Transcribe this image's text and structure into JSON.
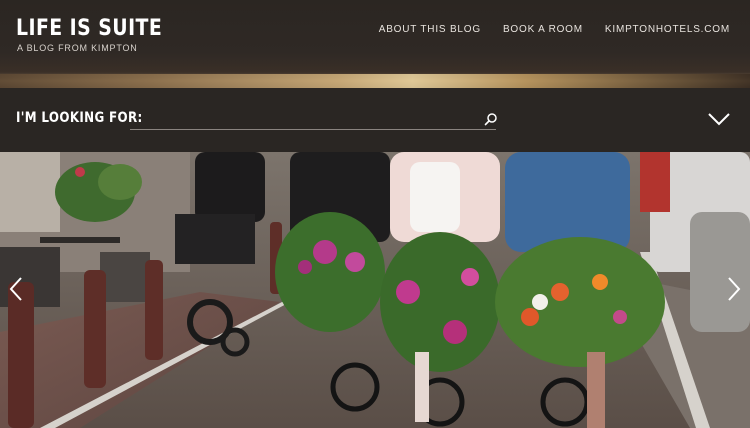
{
  "brand": {
    "title": "LIFE IS SUITE",
    "subtitle": "A BLOG FROM KIMPTON"
  },
  "nav": {
    "items": [
      "ABOUT THIS BLOG",
      "BOOK A ROOM",
      "KIMPTONHOTELS.COM"
    ]
  },
  "search": {
    "label": "I'M LOOKING FOR:",
    "value": "",
    "placeholder": ""
  },
  "hero": {
    "icons": [
      "chevron-left-icon",
      "chevron-right-icon"
    ]
  },
  "colors": {
    "header_bg": "#2b2622",
    "search_bg": "#2a2623",
    "text_light": "#ffffff"
  }
}
